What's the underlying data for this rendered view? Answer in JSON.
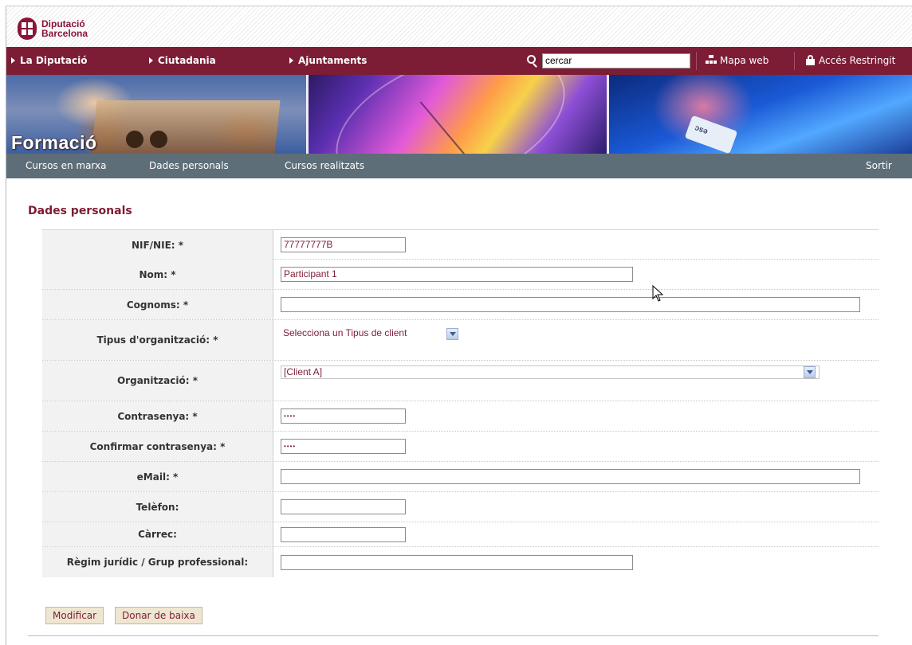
{
  "header": {
    "logo_line1": "Diputació",
    "logo_line2": "Barcelona"
  },
  "mainnav": {
    "items": [
      "La Diputació",
      "Ciutadania",
      "Ajuntaments"
    ],
    "search_value": "cercar",
    "sitemap_label": "Mapa web",
    "restricted_label": "Accés Restringit",
    "bg_color": "#7d1c35"
  },
  "banner": {
    "title": "Formació",
    "key_label": "esc"
  },
  "subnav": {
    "items": [
      "Cursos en marxa",
      "Dades personals",
      "Cursos realitzats"
    ],
    "logout_label": "Sortir"
  },
  "page_title": "Dades personals",
  "form": {
    "nif_label": "NIF/NIE: *",
    "nif_value": "77777777B",
    "nom_label": "Nom: *",
    "nom_value": "Participant 1",
    "cognoms_label": "Cognoms: *",
    "cognoms_value": "",
    "tipus_label": "Tipus d'organització: *",
    "tipus_value": "Selecciona un Tipus de client",
    "org_label": "Organització: *",
    "org_value": "[Client A]",
    "pwd_label": "Contrasenya: *",
    "pwd_value": "••••",
    "pwd2_label": "Confirmar contrasenya: *",
    "pwd2_value": "••••",
    "email_label": "eMail: *",
    "email_value": "",
    "tel_label": "Telèfon:",
    "tel_value": "",
    "carrec_label": "Càrrec:",
    "carrec_value": "",
    "regim_label": "Règim jurídic / Grup professional:",
    "regim_value": ""
  },
  "buttons": {
    "modify_label": "Modificar",
    "unsubscribe_label": "Donar de baixa"
  }
}
